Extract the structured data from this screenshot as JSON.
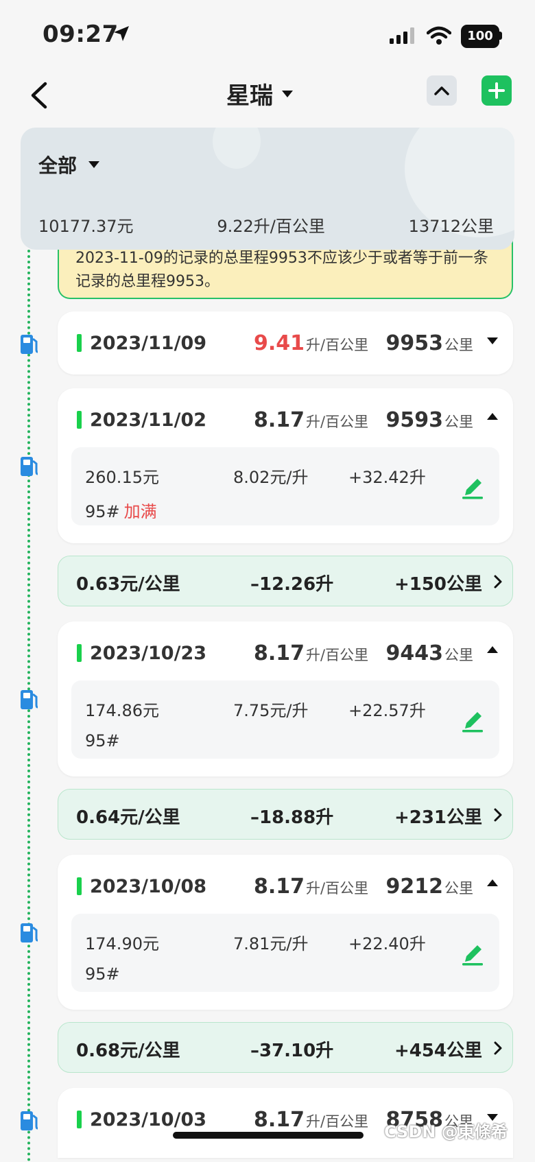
{
  "status_bar": {
    "time": "09:27",
    "battery": "100"
  },
  "nav": {
    "title": "星瑞"
  },
  "summary": {
    "filter": "全部",
    "total_cost": "10177.37元",
    "avg_consumption": "9.22升/百公里",
    "total_distance": "13712公里"
  },
  "warning": {
    "text": "2023-11-09的记录的总里程9953不应该少于或者等于前一条记录的总里程9953。"
  },
  "entries": [
    {
      "date": "2023/11/09",
      "eff": "9.41",
      "eff_unit": "升/百公里",
      "odo": "9953",
      "odo_unit": "公里",
      "expanded": false,
      "highlight": true
    },
    {
      "date": "2023/11/02",
      "eff": "8.17",
      "eff_unit": "升/百公里",
      "odo": "9593",
      "odo_unit": "公里",
      "expanded": true,
      "cost": "260.15元",
      "price": "8.02元/升",
      "volume": "+32.42升",
      "grade": "95#",
      "full": "加满"
    },
    {
      "date": "2023/10/23",
      "eff": "8.17",
      "eff_unit": "升/百公里",
      "odo": "9443",
      "odo_unit": "公里",
      "expanded": true,
      "cost": "174.86元",
      "price": "7.75元/升",
      "volume": "+22.57升",
      "grade": "95#",
      "full": ""
    },
    {
      "date": "2023/10/08",
      "eff": "8.17",
      "eff_unit": "升/百公里",
      "odo": "9212",
      "odo_unit": "公里",
      "expanded": true,
      "cost": "174.90元",
      "price": "7.81元/升",
      "volume": "+22.40升",
      "grade": "95#",
      "full": ""
    },
    {
      "date": "2023/10/03",
      "eff": "8.17",
      "eff_unit": "升/百公里",
      "odo": "8758",
      "odo_unit": "公里",
      "expanded": false
    }
  ],
  "intervals": [
    {
      "cost_per_km": "0.63元/公里",
      "volume_delta": "–12.26升",
      "distance": "+150公里"
    },
    {
      "cost_per_km": "0.64元/公里",
      "volume_delta": "–18.88升",
      "distance": "+231公里"
    },
    {
      "cost_per_km": "0.68元/公里",
      "volume_delta": "–37.10升",
      "distance": "+454公里"
    }
  ],
  "watermark": "CSDN @東條希",
  "colors": {
    "accent": "#1ec15f",
    "warning_bg": "#fbefbc",
    "alert_red": "#e84a4a",
    "interval_bg": "#e6f5ee"
  }
}
